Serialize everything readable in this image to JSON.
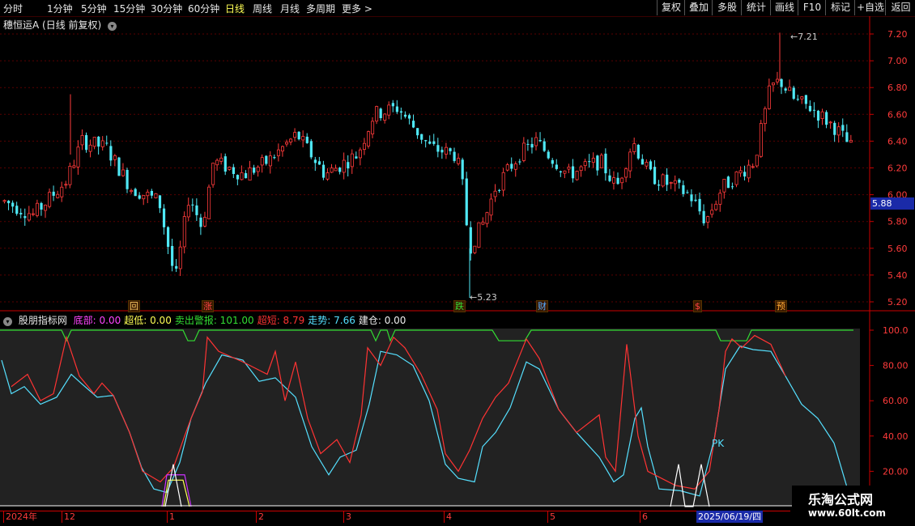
{
  "toolbar": {
    "periods": [
      "分时",
      "1分钟",
      "5分钟",
      "15分钟",
      "30分钟",
      "60分钟",
      "日线",
      "周线",
      "月线",
      "多周期",
      "更多 >"
    ],
    "active": "日线",
    "buttons": [
      "复权",
      "叠加",
      "多股",
      "统计",
      "画线",
      "F10",
      "标记",
      "+自选",
      "返回"
    ]
  },
  "price_title": "穗恒运A (日线 前复权)",
  "price_axis": [
    "7.20",
    "7.00",
    "6.80",
    "6.60",
    "6.40",
    "6.20",
    "6.00",
    "5.80",
    "5.60",
    "5.40",
    "5.20"
  ],
  "current_price": "5.88",
  "annotations": {
    "high": "7.21",
    "low": "5.23"
  },
  "event_marks": [
    {
      "label": "回",
      "color": "#ffcc66"
    },
    {
      "label": "涨",
      "color": "#ff4444"
    },
    {
      "label": "跌",
      "color": "#33dd33"
    },
    {
      "label": "财",
      "color": "#55aaff"
    },
    {
      "label": "$",
      "color": "#ff4444"
    },
    {
      "label": "预",
      "color": "#ffaa33"
    }
  ],
  "indicator": {
    "name": "股朋指标网",
    "items": [
      {
        "label": "底部:",
        "value": "0.00",
        "color": "#ff44ff"
      },
      {
        "label": "超低:",
        "value": "0.00",
        "color": "#ffff55"
      },
      {
        "label": "卖出警报:",
        "value": "101.00",
        "color": "#33dd33"
      },
      {
        "label": "超短:",
        "value": "8.79",
        "color": "#ff3333"
      },
      {
        "label": "走势:",
        "value": "7.66",
        "color": "#55e0ff"
      },
      {
        "label": "建仓:",
        "value": "0.00",
        "color": "#eeeeee"
      }
    ],
    "axis": [
      "100.0",
      "80.00",
      "60.00",
      "40.00",
      "20.00"
    ],
    "pk_label": "PK"
  },
  "date_axis": {
    "labels": [
      "2024年",
      "12",
      "1",
      "2",
      "3",
      "4",
      "5",
      "6"
    ],
    "cursor": "2025/06/19/四"
  },
  "watermark": {
    "line1": "乐淘公式网",
    "line2": "www.60lt.com"
  }
}
